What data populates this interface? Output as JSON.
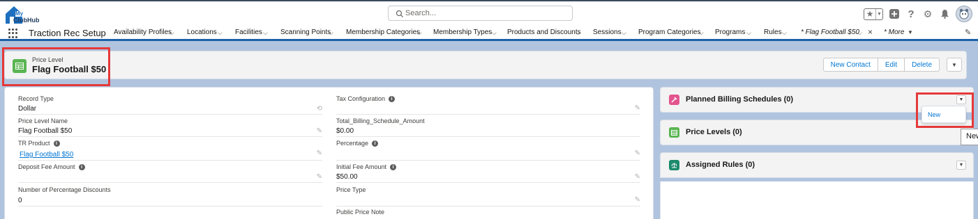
{
  "header": {
    "logo_text": "My ClubHub",
    "search_placeholder": "Search..."
  },
  "nav": {
    "app_name": "Traction Rec Setup",
    "items": [
      "Availability Profiles",
      "Locations",
      "Facilities",
      "Scanning Points",
      "Membership Categories",
      "Membership Types",
      "Products and Discounts",
      "Sessions",
      "Program Categories",
      "Programs",
      "Rules"
    ],
    "active_tab": "* Flag Football $50",
    "more": "* More"
  },
  "record": {
    "object_type": "Price Level",
    "title": "Flag Football $50",
    "actions": [
      "New Contact",
      "Edit",
      "Delete"
    ]
  },
  "fields": {
    "left": [
      {
        "label": "Record Type",
        "value": "Dollar"
      },
      {
        "label": "Price Level Name",
        "value": "Flag Football $50"
      },
      {
        "label": "TR Product",
        "value": "Flag Football $50"
      },
      {
        "label": "Deposit Fee Amount",
        "value": ""
      },
      {
        "label": "Number of Percentage Discounts",
        "value": "0"
      }
    ],
    "right": [
      {
        "label": "Tax Configuration",
        "value": ""
      },
      {
        "label": "Total_Billing_Schedule_Amount",
        "value": "$0.00"
      },
      {
        "label": "Percentage",
        "value": ""
      },
      {
        "label": "Initial Fee Amount",
        "value": "$50.00"
      },
      {
        "label": "Price Type",
        "value": ""
      },
      {
        "label": "Public Price Note",
        "value": ""
      }
    ]
  },
  "related": [
    {
      "title": "Planned Billing Schedules (0)",
      "color": "#e3558e"
    },
    {
      "title": "Price Levels (0)",
      "color": "#5ab552"
    },
    {
      "title": "Assigned Rules (0)",
      "color": "#1b8a6b"
    }
  ],
  "dropdown": {
    "option": "New"
  },
  "tooltip": "New",
  "colors": {
    "brand": "#1b61a8",
    "link": "#0176d3",
    "highlight": "#e53939"
  }
}
